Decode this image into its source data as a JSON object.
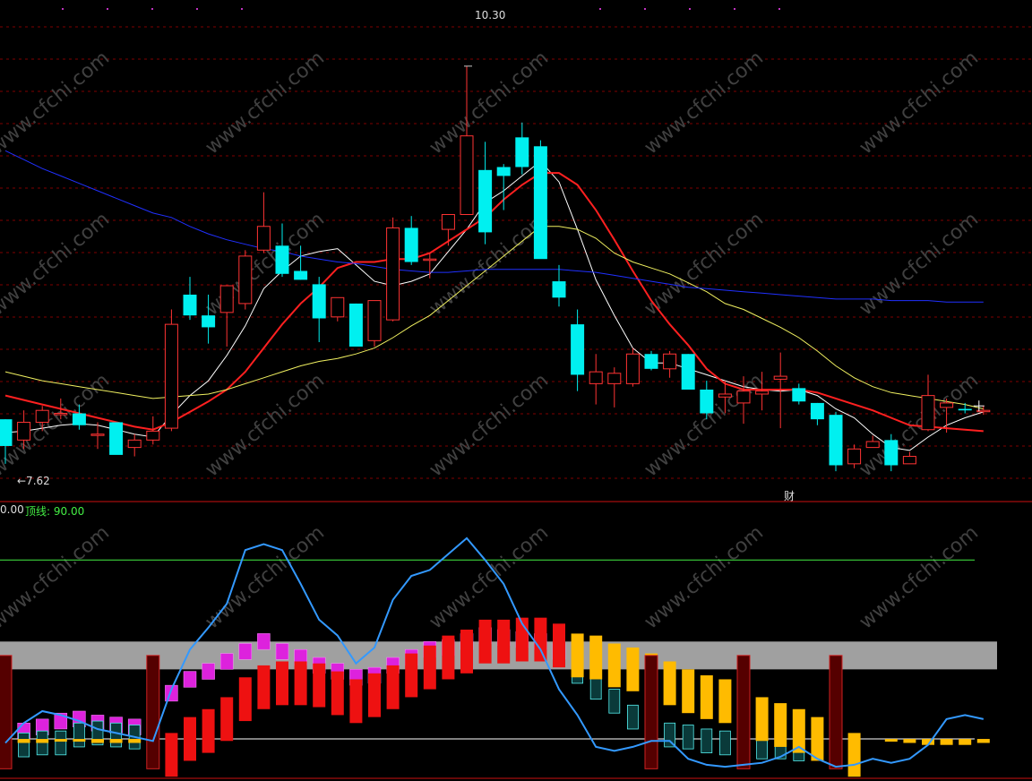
{
  "colors": {
    "up": "#ff3333",
    "down": "#00f0f0",
    "ma5": "#ffffff",
    "ma10": "#ff2020",
    "ma20": "#f0f060",
    "ma60": "#2030ff",
    "grid": "#800000",
    "band": "#a0a0a0",
    "top_line": "#44ee44",
    "osc": "#3399ff",
    "watermark": "#404040"
  },
  "price_panel": {
    "high_label": "10.30",
    "low_label": "←7.62",
    "marker_label": "财",
    "watermark": "www.cfchi.com"
  },
  "indicator_panel": {
    "left_value": "0.00",
    "top_line_label": "顶线: 90.00"
  },
  "chart_data": [
    {
      "type": "candlestick",
      "title": "",
      "x": [
        1,
        2,
        3,
        4,
        5,
        6,
        7,
        8,
        9,
        10,
        11,
        12,
        13,
        14,
        15,
        16,
        17,
        18,
        19,
        20,
        21,
        22,
        23,
        24,
        25,
        26,
        27,
        28,
        29,
        30,
        31,
        32,
        33,
        34,
        35,
        36,
        37,
        38,
        39,
        40,
        41,
        42,
        43,
        44,
        45,
        46,
        47,
        48,
        49,
        50,
        51,
        52,
        53,
        54
      ],
      "ylim": [
        7.45,
        10.45
      ],
      "annotations": [
        {
          "x": 26,
          "y": 10.3,
          "text": "10.30"
        },
        {
          "x": 1,
          "y": 7.62,
          "text": "←7.62"
        }
      ],
      "series": [
        {
          "name": "",
          "ohlc": [
            [
              7.92,
              7.92,
              7.62,
              7.74
            ],
            [
              7.78,
              7.98,
              7.72,
              7.9
            ],
            [
              7.9,
              8.01,
              7.84,
              7.98
            ],
            [
              7.96,
              8.06,
              7.92,
              7.96
            ],
            [
              7.96,
              8.02,
              7.85,
              7.88
            ],
            [
              7.82,
              7.9,
              7.72,
              7.82
            ],
            [
              7.9,
              7.9,
              7.7,
              7.68
            ],
            [
              7.73,
              7.82,
              7.67,
              7.78
            ],
            [
              7.78,
              7.94,
              7.75,
              7.84
            ],
            [
              7.86,
              8.66,
              7.84,
              8.56
            ],
            [
              8.76,
              8.88,
              8.59,
              8.62
            ],
            [
              8.62,
              8.76,
              8.43,
              8.54
            ],
            [
              8.64,
              8.7,
              8.41,
              8.82
            ],
            [
              8.7,
              9.06,
              8.66,
              9.02
            ],
            [
              9.06,
              9.45,
              9.04,
              9.22
            ],
            [
              9.09,
              9.24,
              8.88,
              8.9
            ],
            [
              8.92,
              9.09,
              8.86,
              8.86
            ],
            [
              8.83,
              8.88,
              8.44,
              8.6
            ],
            [
              8.61,
              8.73,
              8.58,
              8.74
            ],
            [
              8.7,
              8.7,
              8.43,
              8.41
            ],
            [
              8.45,
              8.66,
              8.41,
              8.72
            ],
            [
              8.59,
              9.28,
              8.58,
              9.21
            ],
            [
              9.21,
              9.29,
              8.96,
              8.98
            ],
            [
              9.0,
              9.04,
              8.87,
              9.0
            ],
            [
              9.2,
              9.28,
              9.09,
              9.3
            ],
            [
              9.3,
              10.3,
              9.3,
              9.83
            ],
            [
              9.6,
              9.79,
              9.1,
              9.18
            ],
            [
              9.62,
              9.64,
              9.33,
              9.56
            ],
            [
              9.82,
              9.92,
              9.57,
              9.62
            ],
            [
              9.76,
              9.8,
              9.02,
              9.0
            ],
            [
              8.85,
              8.96,
              8.68,
              8.74
            ],
            [
              8.56,
              8.66,
              8.11,
              8.22
            ],
            [
              8.16,
              8.36,
              8.02,
              8.24
            ],
            [
              8.16,
              8.27,
              8.0,
              8.23
            ],
            [
              8.16,
              8.4,
              8.14,
              8.36
            ],
            [
              8.36,
              8.38,
              8.25,
              8.26
            ],
            [
              8.26,
              8.38,
              8.2,
              8.36
            ],
            [
              8.36,
              8.36,
              8.12,
              8.12
            ],
            [
              8.12,
              8.18,
              7.92,
              7.96
            ],
            [
              8.07,
              8.18,
              7.96,
              8.09
            ],
            [
              8.03,
              8.21,
              7.89,
              8.11
            ],
            [
              8.09,
              8.24,
              7.98,
              8.11
            ],
            [
              8.19,
              8.37,
              7.86,
              8.21
            ],
            [
              8.13,
              8.16,
              8.02,
              8.04
            ],
            [
              8.03,
              8.03,
              7.88,
              7.92
            ],
            [
              7.95,
              7.97,
              7.57,
              7.61
            ],
            [
              7.62,
              7.75,
              7.59,
              7.72
            ],
            [
              7.73,
              7.81,
              7.74,
              7.77
            ],
            [
              7.78,
              7.82,
              7.57,
              7.61
            ],
            [
              7.62,
              7.7,
              7.62,
              7.67
            ],
            [
              7.85,
              8.22,
              7.84,
              8.08
            ],
            [
              8.0,
              8.06,
              7.83,
              8.03
            ],
            [
              7.99,
              8.03,
              7.96,
              7.98
            ],
            [
              7.98,
              8.01,
              7.95,
              7.98
            ]
          ]
        }
      ],
      "moving_averages": [
        {
          "name": "",
          "values": [
            7.83,
            7.84,
            7.86,
            7.88,
            7.89,
            7.88,
            7.85,
            7.82,
            7.8,
            7.95,
            8.08,
            8.18,
            8.35,
            8.55,
            8.8,
            8.92,
            9.02,
            9.05,
            9.07,
            8.96,
            8.85,
            8.82,
            8.85,
            8.9,
            9.05,
            9.2,
            9.38,
            9.46,
            9.56,
            9.66,
            9.52,
            9.2,
            8.86,
            8.62,
            8.4,
            8.3,
            8.3,
            8.26,
            8.22,
            8.18,
            8.14,
            8.12,
            8.11,
            8.12,
            8.08,
            7.99,
            7.93,
            7.82,
            7.73,
            7.71,
            7.8,
            7.88,
            7.93,
            7.97
          ]
        },
        {
          "name": "",
          "values": [
            8.08,
            8.05,
            8.02,
            7.99,
            7.96,
            7.93,
            7.9,
            7.87,
            7.85,
            7.9,
            7.97,
            8.04,
            8.12,
            8.24,
            8.4,
            8.56,
            8.7,
            8.81,
            8.94,
            8.98,
            8.98,
            9.0,
            9.0,
            9.04,
            9.12,
            9.2,
            9.28,
            9.4,
            9.5,
            9.58,
            9.58,
            9.5,
            9.33,
            9.13,
            8.92,
            8.72,
            8.56,
            8.42,
            8.26,
            8.16,
            8.12,
            8.12,
            8.12,
            8.12,
            8.1,
            8.06,
            8.02,
            7.98,
            7.93,
            7.88,
            7.87,
            7.86,
            7.85,
            7.84
          ]
        },
        {
          "name": "",
          "values": [
            8.24,
            8.21,
            8.18,
            8.16,
            8.14,
            8.12,
            8.1,
            8.08,
            8.06,
            8.07,
            8.08,
            8.09,
            8.12,
            8.16,
            8.2,
            8.24,
            8.28,
            8.31,
            8.33,
            8.36,
            8.4,
            8.47,
            8.55,
            8.62,
            8.72,
            8.82,
            8.92,
            9.02,
            9.12,
            9.22,
            9.22,
            9.2,
            9.14,
            9.04,
            8.98,
            8.94,
            8.9,
            8.84,
            8.78,
            8.7,
            8.66,
            8.6,
            8.54,
            8.47,
            8.38,
            8.28,
            8.2,
            8.14,
            8.1,
            8.08,
            8.06,
            8.04,
            8.02,
            7.99
          ]
        },
        {
          "name": "",
          "values": [
            9.73,
            9.67,
            9.61,
            9.56,
            9.51,
            9.46,
            9.41,
            9.36,
            9.31,
            9.28,
            9.22,
            9.17,
            9.13,
            9.1,
            9.07,
            9.05,
            9.02,
            9.0,
            8.98,
            8.97,
            8.95,
            8.93,
            8.92,
            8.91,
            8.91,
            8.92,
            8.93,
            8.93,
            8.93,
            8.93,
            8.93,
            8.92,
            8.91,
            8.89,
            8.87,
            8.85,
            8.83,
            8.81,
            8.8,
            8.79,
            8.78,
            8.77,
            8.76,
            8.75,
            8.74,
            8.73,
            8.73,
            8.73,
            8.72,
            8.72,
            8.72,
            8.71,
            8.71,
            8.71
          ]
        }
      ]
    },
    {
      "type": "bar",
      "title": "",
      "ylim": [
        -18,
        105
      ],
      "reference_lines": [
        {
          "label": "顶线: 90.00",
          "value": 90
        },
        {
          "label": "",
          "value": 0
        }
      ],
      "band": [
        35,
        49
      ],
      "series": [
        {
          "name": "",
          "color": "#3399ff",
          "values": [
            -2,
            8,
            14,
            12,
            9,
            5,
            3,
            1,
            -1,
            25,
            45,
            56,
            68,
            95,
            98,
            95,
            78,
            60,
            52,
            38,
            46,
            70,
            82,
            85,
            93,
            101,
            90,
            78,
            58,
            45,
            25,
            12,
            -4,
            -6,
            -4,
            -1,
            -1,
            -10,
            -13,
            -14,
            -13,
            -12,
            -9,
            -4,
            -10,
            -14,
            -13,
            -10,
            -12,
            -10,
            -3,
            10,
            12,
            10
          ]
        },
        {
          "name": "",
          "color": "#ee1111",
          "values": [
            0,
            0,
            0,
            0,
            0,
            0,
            0,
            0,
            0,
            3,
            11,
            15,
            21,
            31,
            37,
            39,
            39,
            38,
            34,
            30,
            33,
            37,
            43,
            47,
            52,
            55,
            60,
            60,
            61,
            61,
            58,
            0,
            0,
            0,
            0,
            0,
            0,
            0,
            0,
            0,
            0,
            0,
            0,
            0,
            0,
            0,
            0,
            0,
            0,
            0,
            0,
            0,
            0,
            0
          ]
        },
        {
          "name": "",
          "color": "#ffbb00",
          "values": [
            -3,
            -2,
            -2,
            -1,
            -1,
            -2,
            -2,
            -2,
            0,
            0,
            0,
            0,
            0,
            0,
            0,
            0,
            0,
            0,
            0,
            0,
            0,
            0,
            0,
            0,
            0,
            0,
            0,
            0,
            0,
            0,
            0,
            53,
            52,
            48,
            46,
            43,
            39,
            35,
            32,
            30,
            25,
            21,
            18,
            15,
            11,
            7,
            3,
            0,
            -1,
            -2,
            -3,
            -3,
            -3,
            -2
          ]
        },
        {
          "name": "",
          "color": "#33dddd",
          "values": [
            3,
            3,
            4,
            4,
            8,
            9,
            8,
            7,
            5,
            0,
            0,
            0,
            0,
            0,
            0,
            0,
            0,
            0,
            0,
            0,
            0,
            0,
            0,
            0,
            0,
            0,
            0,
            0,
            0,
            0,
            0,
            40,
            32,
            25,
            17,
            12,
            8,
            7,
            5,
            4,
            3,
            2,
            2,
            1,
            2,
            1,
            1,
            0,
            0,
            0,
            0,
            0,
            0,
            0
          ]
        },
        {
          "name": "",
          "color": "#dd22dd",
          "values": [
            6,
            8,
            10,
            13,
            14,
            12,
            11,
            10,
            9,
            27,
            34,
            38,
            43,
            48,
            53,
            48,
            45,
            41,
            38,
            35,
            36,
            41,
            45,
            49,
            50,
            53,
            56,
            55,
            54,
            53,
            48,
            0,
            0,
            0,
            0,
            0,
            0,
            0,
            0,
            0,
            0,
            0,
            0,
            0,
            0,
            0,
            0,
            0,
            0,
            0,
            0,
            0,
            0,
            0
          ]
        }
      ]
    }
  ]
}
